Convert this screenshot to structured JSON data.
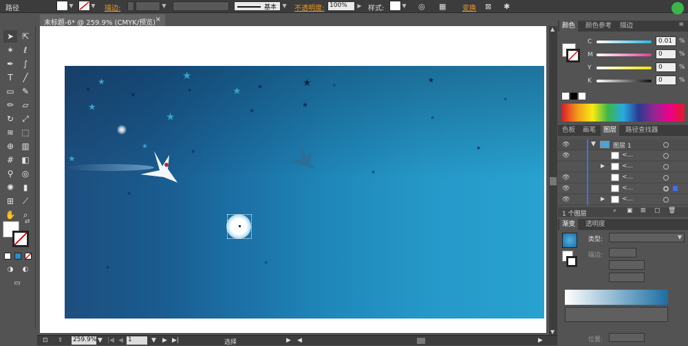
{
  "control_bar": {
    "mode_label": "路径",
    "stroke_label": "描边:",
    "stroke_style_label": "基本",
    "opacity_label": "不透明度:",
    "opacity_value": "100%",
    "style_label": "样式:",
    "transform_label": "变换"
  },
  "document": {
    "tab_title": "未标题-6* @ 259.9% (CMYK/预览)",
    "close_icon": "close-icon"
  },
  "status_bar": {
    "zoom": "259.9%",
    "page": "1",
    "tool_status": "选择"
  },
  "color_panel": {
    "tabs": [
      "颜色",
      "颜色参考",
      "描边"
    ],
    "channels": [
      {
        "label": "C",
        "value": "0.01",
        "unit": "%",
        "color": "#28b6e3"
      },
      {
        "label": "M",
        "value": "0",
        "unit": "%",
        "color": "#e23d95"
      },
      {
        "label": "Y",
        "value": "0",
        "unit": "%",
        "color": "#f2e500"
      },
      {
        "label": "K",
        "value": "0",
        "unit": "%",
        "color": "#444444"
      }
    ]
  },
  "layers_panel": {
    "tabs": [
      "色板",
      "画笔",
      "图层",
      "路径查找器"
    ],
    "layer_name": "图层 1",
    "sublayers": [
      "<...",
      "<...",
      "<...",
      "<...",
      "<..."
    ],
    "footer": "1 个图层"
  },
  "gradient_panel": {
    "tabs": [
      "渐变",
      "透明度"
    ],
    "type_label": "类型:",
    "stroke_label": "描边:",
    "position_label": "位置:"
  },
  "colors": {
    "accent_orange": "#e89a2b",
    "ui_dark": "#3c3c3c",
    "ui_mid": "#535353",
    "art_blue": "#2598c8"
  }
}
